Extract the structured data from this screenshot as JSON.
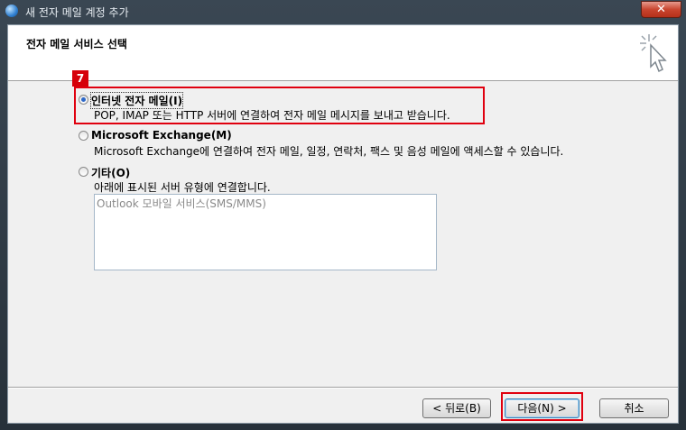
{
  "window": {
    "title": "새 전자 메일 계정 추가",
    "close_label": "✕"
  },
  "header": {
    "title": "전자 메일 서비스 선택",
    "icon": "wizard-cursor-icon"
  },
  "annotations": {
    "step_number": "7"
  },
  "options": [
    {
      "label": "인터넷 전자 메일(I)",
      "description": "POP, IMAP 또는 HTTP 서버에 연결하여 전자 메일 메시지를 보내고 받습니다.",
      "selected": true
    },
    {
      "label": "Microsoft Exchange(M)",
      "description": "Microsoft Exchange에 연결하여 전자 메일, 일정, 연락처, 팩스 및 음성 메일에 액세스할 수 있습니다.",
      "selected": false
    },
    {
      "label": "기타(O)",
      "description": "아래에 표시된 서버 유형에 연결합니다.",
      "selected": false
    }
  ],
  "other_list": {
    "items": [
      "Outlook 모바일 서비스(SMS/MMS)"
    ]
  },
  "buttons": {
    "back": "< 뒤로(B)",
    "next": "다음(N) >",
    "cancel": "취소"
  },
  "colors": {
    "highlight": "#e0000f",
    "radio_accent": "#2d68c8"
  }
}
